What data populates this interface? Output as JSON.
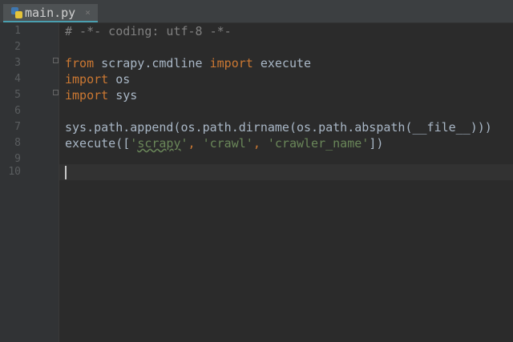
{
  "tab": {
    "filename": "main.py",
    "close": "×",
    "icon": "python-file-icon"
  },
  "line_numbers": [
    "1",
    "2",
    "3",
    "4",
    "5",
    "6",
    "7",
    "8",
    "9",
    "10"
  ],
  "code": {
    "l1": "# -*- coding: utf-8 -*-",
    "l3_kw1": "from",
    "l3_mid": " scrapy.cmdline ",
    "l3_kw2": "import",
    "l3_end": " execute",
    "l4_kw": "import",
    "l4_end": " os",
    "l5_kw": "import",
    "l5_end": " sys",
    "l7": "sys.path.append(os.path.dirname(os.path.abspath(__file__)))",
    "l8_a": "execute([",
    "l8_s1q": "'",
    "l8_s1": "scrapy",
    "l8_s1e": "'",
    "l8_c1": ", ",
    "l8_s2": "'crawl'",
    "l8_c2": ", ",
    "l8_s3": "'crawler_name'",
    "l8_end": "])"
  },
  "colors": {
    "keyword": "#cc7832",
    "string": "#6a8759",
    "comment": "#808080",
    "text": "#a9b7c6",
    "accent": "#4a9fb0"
  }
}
